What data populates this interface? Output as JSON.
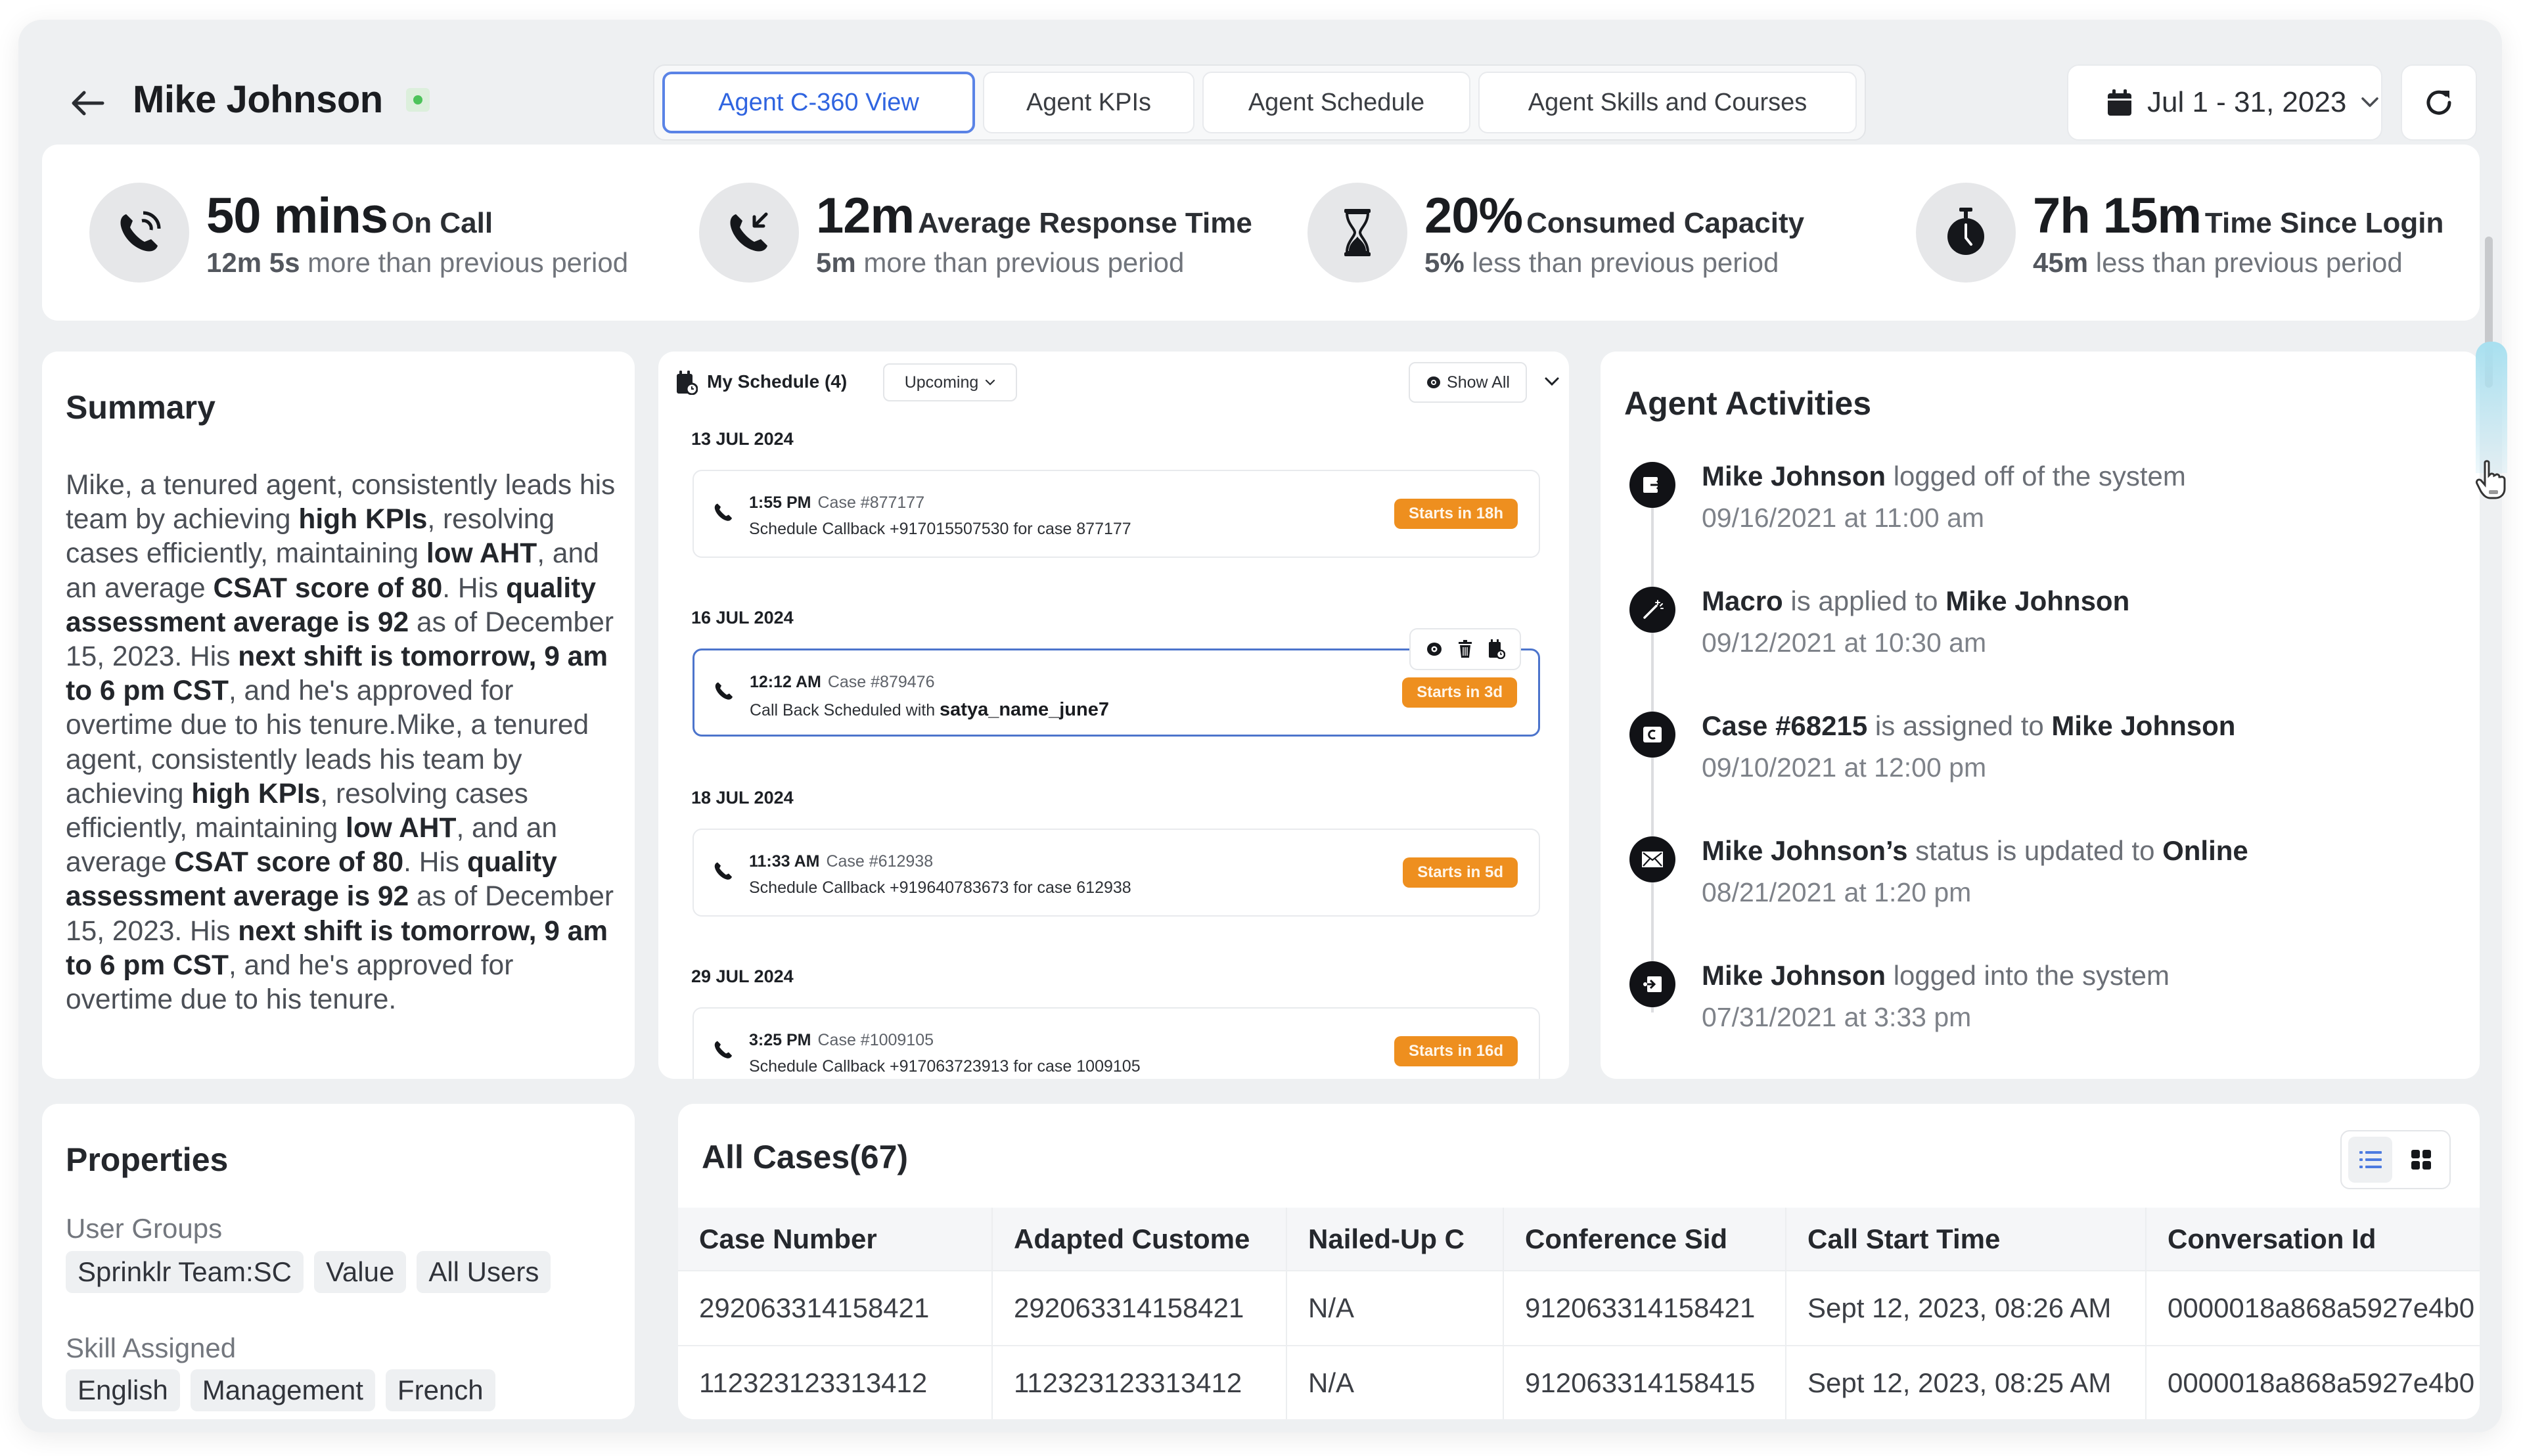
{
  "header": {
    "agent_name": "Mike Johnson",
    "status_color": "#4cc35a",
    "tabs": [
      {
        "label": "Agent C-360 View",
        "active": true
      },
      {
        "label": "Agent KPIs",
        "active": false
      },
      {
        "label": "Agent Schedule",
        "active": false
      },
      {
        "label": "Agent Skills and Courses",
        "active": false
      }
    ],
    "date_range": "Jul 1 - 31, 2023"
  },
  "kpis": [
    {
      "icon": "phone-ringing-icon",
      "value": "50 mins",
      "label": "On Call",
      "delta": "12m 5s",
      "delta_text": "more than previous period"
    },
    {
      "icon": "phone-callback-icon",
      "value": "12m",
      "label": "Average Response Time",
      "delta": "5m",
      "delta_text": "more than previous period"
    },
    {
      "icon": "hourglass-icon",
      "value": "20%",
      "label": "Consumed Capacity",
      "delta": "5%",
      "delta_text": "less than previous period"
    },
    {
      "icon": "stopwatch-icon",
      "value": "7h 15m",
      "label": "Time Since Login",
      "delta": "45m",
      "delta_text": "less than previous period"
    }
  ],
  "summary": {
    "title": "Summary",
    "paragraph_parts": [
      {
        "t": "Mike, a tenured agent, consistently leads his team by achieving ",
        "b": false
      },
      {
        "t": "high KPIs",
        "b": true
      },
      {
        "t": ", resolving cases efficiently, maintaining ",
        "b": false
      },
      {
        "t": "low AHT",
        "b": true
      },
      {
        "t": ", and an average ",
        "b": false
      },
      {
        "t": "CSAT score of 80",
        "b": true
      },
      {
        "t": ". His ",
        "b": false
      },
      {
        "t": "quality assessment average is 92",
        "b": true
      },
      {
        "t": " as of December 15, 2023. His ",
        "b": false
      },
      {
        "t": "next shift is tomorrow, 9 am to 6 pm CST",
        "b": true
      },
      {
        "t": ", and he's approved for overtime due to his tenure.Mike, a tenured agent, consistently leads his team by achieving ",
        "b": false
      },
      {
        "t": "high KPIs",
        "b": true
      },
      {
        "t": ", resolving cases efficiently, maintaining ",
        "b": false
      },
      {
        "t": "low AHT",
        "b": true
      },
      {
        "t": ", and an average ",
        "b": false
      },
      {
        "t": "CSAT score of 80",
        "b": true
      },
      {
        "t": ". His ",
        "b": false
      },
      {
        "t": "quality assessment average is 92",
        "b": true
      },
      {
        "t": " as of December 15, 2023. His ",
        "b": false
      },
      {
        "t": "next shift is tomorrow, 9 am to 6 pm CST",
        "b": true
      },
      {
        "t": ", and he's approved for overtime due to his tenure.",
        "b": false
      }
    ]
  },
  "schedule": {
    "title": "My Schedule (4)",
    "filter": "Upcoming",
    "show_all": "Show All",
    "badge_color": "#ee8f1f",
    "groups": [
      {
        "date": "13 JUL 2024",
        "time": "1:55 PM",
        "case": "Case #877177",
        "desc": "Schedule Callback +917015507530 for case 877177",
        "desc_bold": "",
        "badge": "Starts in 18h",
        "hover": false
      },
      {
        "date": "16 JUL 2024",
        "time": "12:12 AM",
        "case": "Case #879476",
        "desc": "Call Back Scheduled with ",
        "desc_bold": "satya_name_june7",
        "badge": "Starts in 3d",
        "hover": true
      },
      {
        "date": "18 JUL 2024",
        "time": "11:33 AM",
        "case": "Case #612938",
        "desc": "Schedule Callback +919640783673 for case 612938",
        "desc_bold": "",
        "badge": "Starts in 5d",
        "hover": false
      },
      {
        "date": "29 JUL 2024",
        "time": "3:25 PM",
        "case": "Case #1009105",
        "desc": "Schedule Callback +917063723913 for case 1009105",
        "desc_bold": "",
        "badge": "Starts in 16d",
        "hover": false
      }
    ]
  },
  "activities": {
    "title": "Agent Activities",
    "items": [
      {
        "icon": "logout-icon",
        "parts": [
          {
            "t": "Mike Johnson",
            "b": true
          },
          {
            "t": " logged off of the system",
            "b": false
          }
        ],
        "time": "09/16/2021 at 11:00 am"
      },
      {
        "icon": "magic-wand-icon",
        "parts": [
          {
            "t": "Macro",
            "b": true
          },
          {
            "t": " is applied to ",
            "b": false
          },
          {
            "t": "Mike Johnson",
            "b": true
          }
        ],
        "time": "09/12/2021 at 10:30 am"
      },
      {
        "icon": "case-icon",
        "parts": [
          {
            "t": "Case #68215",
            "b": true
          },
          {
            "t": " is assigned to ",
            "b": false
          },
          {
            "t": "Mike Johnson",
            "b": true
          }
        ],
        "time": "09/10/2021 at 12:00 pm"
      },
      {
        "icon": "envelope-icon",
        "parts": [
          {
            "t": "Mike Johnson’s",
            "b": true
          },
          {
            "t": " status is updated to ",
            "b": false
          },
          {
            "t": "Online",
            "b": true
          }
        ],
        "time": "08/21/2021 at 1:20 pm"
      },
      {
        "icon": "login-icon",
        "parts": [
          {
            "t": "Mike Johnson",
            "b": true
          },
          {
            "t": " logged into the system",
            "b": false
          }
        ],
        "time": "07/31/2021 at 3:33 pm"
      }
    ]
  },
  "properties": {
    "title": "Properties",
    "user_groups_label": "User Groups",
    "user_groups": [
      "Sprinklr Team:SC",
      "Value",
      "All Users"
    ],
    "skills_label": "Skill Assigned",
    "skills": [
      "English",
      "Management",
      "French"
    ]
  },
  "cases": {
    "title": "All Cases(67)",
    "columns": [
      "Case Number",
      "Adapted Custome",
      "Nailed-Up C",
      "Conference Sid",
      "Call Start Time",
      "Conversation Id"
    ],
    "rows": [
      [
        "292063314158421",
        "292063314158421",
        "N/A",
        "912063314158421",
        "Sept 12, 2023, 08:26 AM",
        "0000018a868a5927e4b0"
      ],
      [
        "112323123313412",
        "112323123313412",
        "N/A",
        "912063314158415",
        "Sept 12, 2023, 08:25 AM",
        "0000018a868a5927e4b0"
      ]
    ],
    "active_view": "list"
  },
  "colors": {
    "accent": "#2f64e0",
    "status_online": "#4cc35a",
    "badge_orange": "#ee8f1f"
  }
}
